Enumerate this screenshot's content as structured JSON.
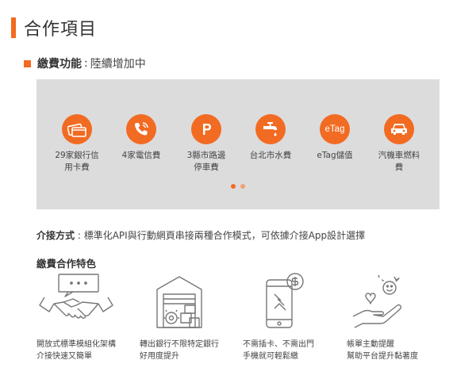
{
  "page_title": "合作項目",
  "payment": {
    "label": "繳費功能",
    "sep": ":",
    "value": "陸續增加中",
    "items": [
      {
        "icon": "credit-card-icon",
        "line1": "29家銀行信",
        "line2": "用卡費"
      },
      {
        "icon": "phone-icon",
        "line1": "4家電信費",
        "line2": ""
      },
      {
        "icon": "parking-icon",
        "line1": "3縣市路邊",
        "line2": "停車費"
      },
      {
        "icon": "faucet-icon",
        "line1": "台北市水費",
        "line2": ""
      },
      {
        "icon": "etag-icon",
        "line1": "eTag儲值",
        "line2": "",
        "badge": "eTag"
      },
      {
        "icon": "car-icon",
        "line1": "汽機車燃料",
        "line2": "費"
      }
    ]
  },
  "method": {
    "label": "介接方式",
    "sep": ":",
    "value": "標準化API與行動網頁串接兩種合作模式，可依據介接App設計選擇"
  },
  "features": {
    "title": "繳費合作特色",
    "items": [
      {
        "icon": "handshake-icon",
        "line1": "開放式標準模組化架構",
        "line2": "介接快速又簡單"
      },
      {
        "icon": "warehouse-icon",
        "line1": "轉出銀行不限特定銀行",
        "line2": "好用度提升"
      },
      {
        "icon": "mobile-coin-icon",
        "line1": "不需插卡、不需出門",
        "line2": "手機就可輕鬆繳"
      },
      {
        "icon": "hand-heart-icon",
        "line1": "帳單主動提醒",
        "line2": "幫助平台提升黏著度"
      }
    ]
  },
  "colors": {
    "accent": "#f26b22",
    "panel": "#dcdcdc"
  }
}
